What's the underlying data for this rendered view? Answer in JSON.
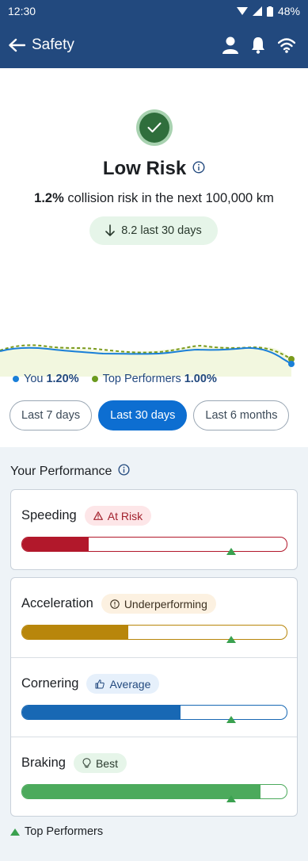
{
  "status_bar": {
    "time": "12:30",
    "battery": "48%"
  },
  "app_bar": {
    "title": "Safety"
  },
  "hero": {
    "risk_level": "Low Risk",
    "collision_pct": "1.2%",
    "collision_text": " collision risk in the next 100,000 km",
    "trend_text": "8.2 last 30 days",
    "colors": {
      "badge_outer": "#a8d2b0",
      "badge_inner": "#2f6e3c"
    }
  },
  "legend": {
    "you_label": "You",
    "you_value": "1.20%",
    "you_color": "#1a7fd8",
    "top_label": "Top Performers",
    "top_value": "1.00%",
    "top_color": "#6b9a1e"
  },
  "range_tabs": [
    "Last 7 days",
    "Last 30 days",
    "Last 6 months"
  ],
  "performance": {
    "title": "Your Performance",
    "metrics": [
      {
        "name": "Speeding",
        "badge": "At Risk",
        "badge_icon": "warning-icon",
        "fill_pct": 25,
        "top_pct": 79,
        "color": "#b2182b",
        "badge_bg": "#fde6e8",
        "badge_fg": "#a3222e"
      },
      {
        "name": "Acceleration",
        "badge": "Underperforming",
        "badge_icon": "info-circle-icon",
        "fill_pct": 40,
        "top_pct": 79,
        "color": "#b8860b",
        "badge_bg": "#fcf1e1",
        "badge_fg": "#3c3020"
      },
      {
        "name": "Cornering",
        "badge": "Average",
        "badge_icon": "thumbs-up-icon",
        "fill_pct": 60,
        "top_pct": 79,
        "color": "#1868b4",
        "badge_bg": "#e6f0fb",
        "badge_fg": "#22497e"
      },
      {
        "name": "Braking",
        "badge": "Best",
        "badge_icon": "lightbulb-icon",
        "fill_pct": 90,
        "top_pct": 79,
        "color": "#4caa5c",
        "badge_bg": "#e6f5e9",
        "badge_fg": "#2a3a2e"
      }
    ],
    "legend_label": "Top Performers"
  }
}
